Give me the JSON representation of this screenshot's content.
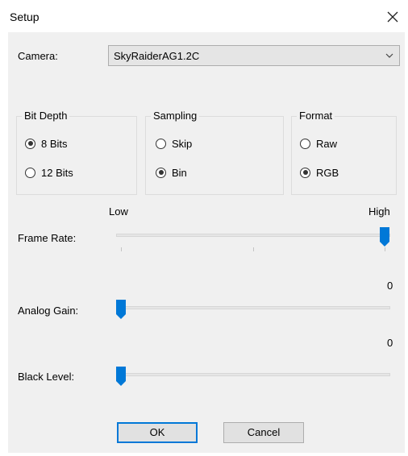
{
  "window": {
    "title": "Setup"
  },
  "camera": {
    "label": "Camera:",
    "selected": "SkyRaiderAG1.2C"
  },
  "bit_depth": {
    "title": "Bit Depth",
    "options": [
      "8 Bits",
      "12 Bits"
    ],
    "selected": "8 Bits"
  },
  "sampling": {
    "title": "Sampling",
    "options": [
      "Skip",
      "Bin"
    ],
    "selected": "Bin"
  },
  "format": {
    "title": "Format",
    "options": [
      "Raw",
      "RGB"
    ],
    "selected": "RGB"
  },
  "frame_rate": {
    "label": "Frame Rate:",
    "low_label": "Low",
    "high_label": "High",
    "value_fraction": 1.0
  },
  "analog_gain": {
    "label": "Analog Gain:",
    "value": "0"
  },
  "black_level": {
    "label": "Black Level:",
    "value": "0"
  },
  "buttons": {
    "ok": "OK",
    "cancel": "Cancel"
  },
  "colors": {
    "accent": "#0078d7",
    "background": "#f0f0f0"
  },
  "icons": {
    "close": "close-icon",
    "dropdown": "chevron-down-icon"
  }
}
